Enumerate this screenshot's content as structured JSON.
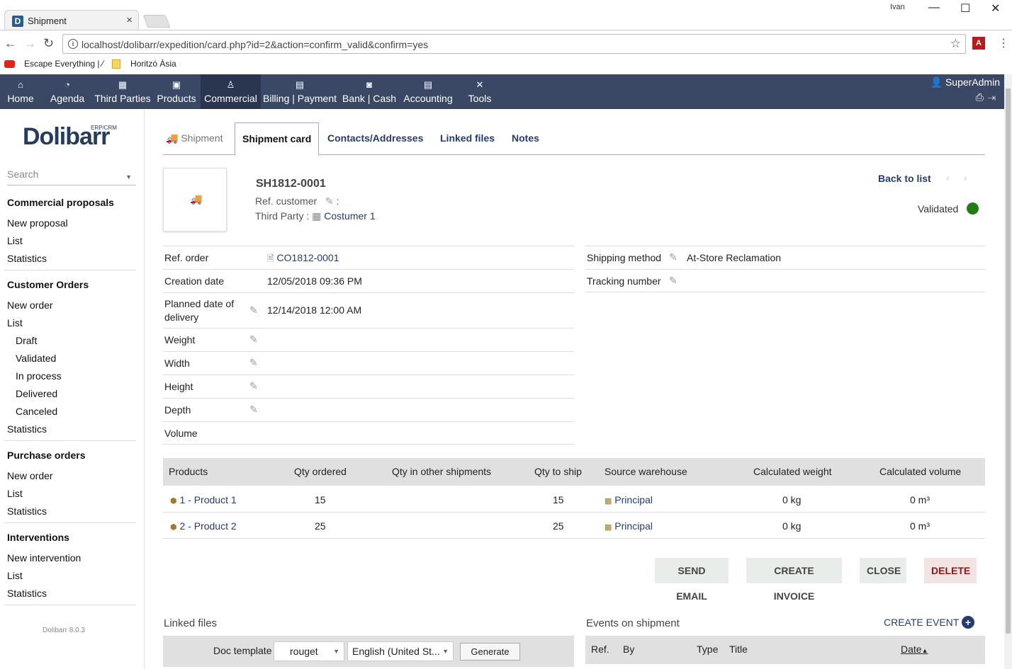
{
  "browser": {
    "tab_title": "Shipment",
    "tab_close": "×",
    "favicon_letter": "D",
    "user": "Ivan",
    "url": "localhost/dolibarr/expedition/card.php?id=2&action=confirm_valid&confirm=yes",
    "bookmarks": [
      {
        "label": "Escape Everything | ⁄"
      },
      {
        "label": "Horitzó Àsia"
      }
    ]
  },
  "topmenu": {
    "items": [
      {
        "label": "Home",
        "icon": "home-icon"
      },
      {
        "label": "Agenda",
        "icon": "agenda-icon"
      },
      {
        "label": "Third Parties",
        "icon": "company-icon"
      },
      {
        "label": "Products",
        "icon": "products-icon"
      },
      {
        "label": "Commercial",
        "icon": "commercial-icon"
      },
      {
        "label": "Billing | Payment",
        "icon": "billing-icon"
      },
      {
        "label": "Bank | Cash",
        "icon": "bank-icon"
      },
      {
        "label": "Accounting",
        "icon": "accounting-icon"
      },
      {
        "label": "Tools",
        "icon": "tools-icon"
      }
    ],
    "user": "SuperAdmin"
  },
  "sidebar": {
    "logo": "Dolibarr",
    "logo_sub": "ERP/CRM",
    "search_placeholder": "Search",
    "sections": [
      {
        "title": "Commercial proposals",
        "items": [
          "New proposal",
          "List",
          "Statistics"
        ]
      },
      {
        "title": "Customer Orders",
        "items": [
          "New order",
          "List",
          "Draft",
          "Validated",
          "In process",
          "Delivered",
          "Canceled",
          "Statistics"
        ]
      },
      {
        "title": "Purchase orders",
        "items": [
          "New order",
          "List",
          "Statistics"
        ]
      },
      {
        "title": "Interventions",
        "items": [
          "New intervention",
          "List",
          "Statistics"
        ]
      }
    ],
    "version": "Dolibarr 8.0.3"
  },
  "tabs": [
    "Shipment",
    "Shipment card",
    "Contacts/Addresses",
    "Linked files",
    "Notes"
  ],
  "header": {
    "ref": "SH1812-0001",
    "ref_customer_label": "Ref. customer",
    "ref_customer_sep": ":",
    "third_party_label": "Third Party :",
    "third_party_value": "Costumer 1",
    "back_to_list": "Back to list",
    "status": "Validated",
    "status_color": "#237c16"
  },
  "fields_left": [
    {
      "key": "Ref. order",
      "value": "CO1812-0001",
      "edit": false
    },
    {
      "key": "Creation date",
      "value": "12/05/2018 09:36 PM",
      "edit": false
    },
    {
      "key": "Planned date of delivery",
      "value": "12/14/2018 12:00 AM",
      "edit": true
    },
    {
      "key": "Weight",
      "value": "",
      "edit": true
    },
    {
      "key": "Width",
      "value": "",
      "edit": true
    },
    {
      "key": "Height",
      "value": "",
      "edit": true
    },
    {
      "key": "Depth",
      "value": "",
      "edit": true
    },
    {
      "key": "Volume",
      "value": "",
      "edit": false
    }
  ],
  "fields_right": [
    {
      "key": "Shipping method",
      "value": "At-Store Reclamation"
    },
    {
      "key": "Tracking number",
      "value": ""
    }
  ],
  "products": {
    "headers": [
      "Products",
      "Qty ordered",
      "Qty in other shipments",
      "Qty to ship",
      "Source warehouse",
      "Calculated weight",
      "Calculated volume"
    ],
    "rows": [
      {
        "product": "1 - Product 1",
        "qty_ordered": "15",
        "qty_other": "",
        "qty_ship": "15",
        "warehouse": "Principal",
        "weight": "0 kg",
        "volume": "0 m³"
      },
      {
        "product": "2 - Product 2",
        "qty_ordered": "25",
        "qty_other": "",
        "qty_ship": "25",
        "warehouse": "Principal",
        "weight": "0 kg",
        "volume": "0 m³"
      }
    ]
  },
  "actions": [
    "SEND EMAIL",
    "CREATE INVOICE",
    "CLOSE",
    "DELETE"
  ],
  "linked_files": {
    "title": "Linked files",
    "doc_template_label": "Doc template",
    "template": "rouget",
    "language": "English (United St...",
    "generate": "Generate"
  },
  "events": {
    "title": "Events on shipment",
    "create": "CREATE EVENT",
    "headers": [
      "Ref.",
      "By",
      "Type",
      "Title",
      "Date"
    ]
  }
}
